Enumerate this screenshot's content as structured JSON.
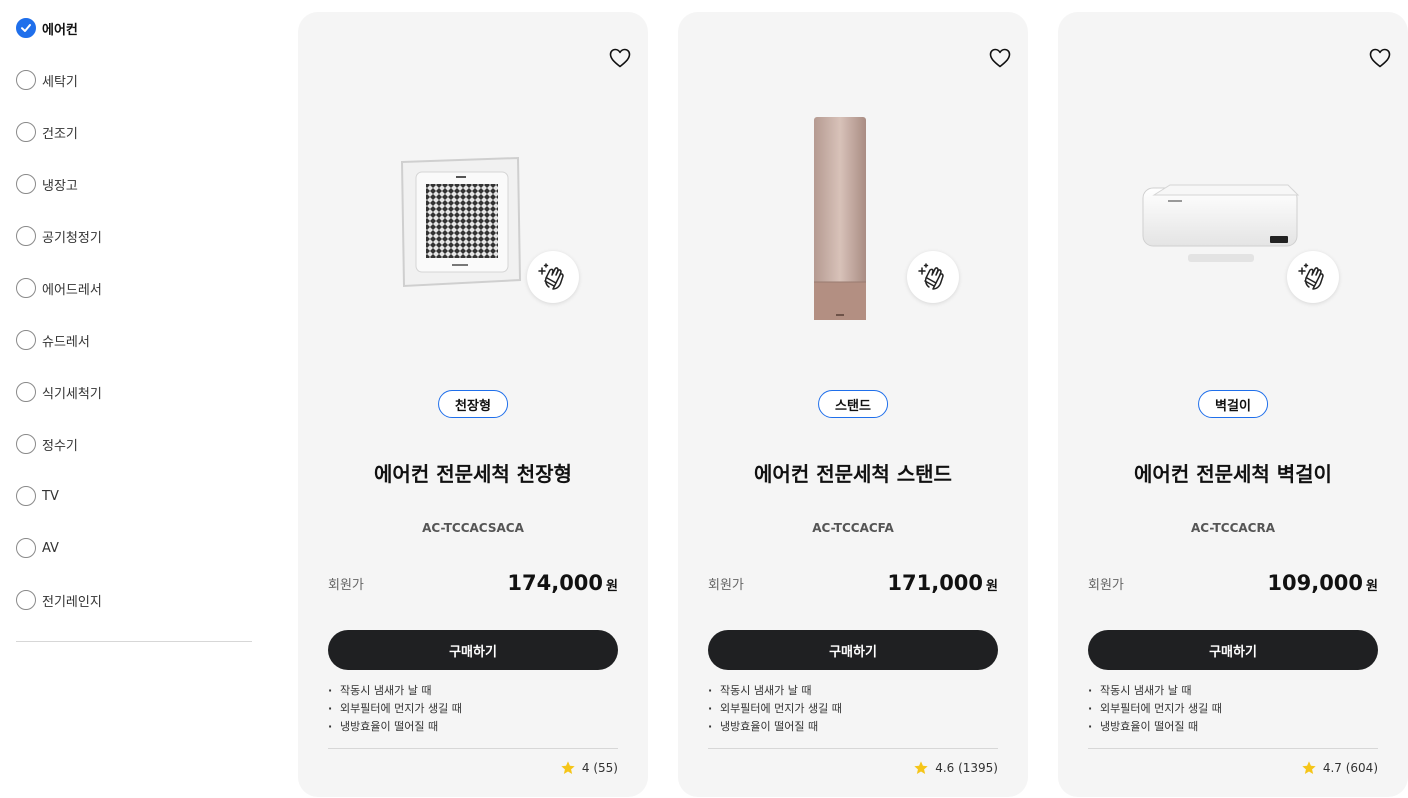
{
  "sidebar": {
    "categories": [
      {
        "label": "에어컨",
        "checked": true
      },
      {
        "label": "세탁기",
        "checked": false
      },
      {
        "label": "건조기",
        "checked": false
      },
      {
        "label": "냉장고",
        "checked": false
      },
      {
        "label": "공기청정기",
        "checked": false
      },
      {
        "label": "에어드레서",
        "checked": false
      },
      {
        "label": "슈드레서",
        "checked": false
      },
      {
        "label": "식기세척기",
        "checked": false
      },
      {
        "label": "정수기",
        "checked": false
      },
      {
        "label": "TV",
        "checked": false
      },
      {
        "label": "AV",
        "checked": false
      },
      {
        "label": "전기레인지",
        "checked": false
      }
    ]
  },
  "colors": {
    "accent": "#1f6feb",
    "card_bg": "#f5f5f5",
    "button_bg": "#1f2022",
    "star": "#f5c518"
  },
  "products": [
    {
      "type_chip": "천장형",
      "title": "에어컨 전문세척 천장형",
      "model": "AC-TCCACSACA",
      "price_label": "회원가",
      "price": "174,000",
      "price_unit": "원",
      "buy_label": "구매하기",
      "bullets": [
        "작동시 냄새가 날 때",
        "외부필터에 먼지가 생길 때",
        "냉방효율이 떨어질 때"
      ],
      "rating": "4 (55)",
      "image_icon": "ceiling-cassette-ac-image",
      "badge_icon": "cleaning-hand-icon",
      "favorite_icon": "heart-icon"
    },
    {
      "type_chip": "스탠드",
      "title": "에어컨 전문세척 스탠드",
      "model": "AC-TCCACFA",
      "price_label": "회원가",
      "price": "171,000",
      "price_unit": "원",
      "buy_label": "구매하기",
      "bullets": [
        "작동시 냄새가 날 때",
        "외부필터에 먼지가 생길 때",
        "냉방효율이 떨어질 때"
      ],
      "rating": "4.6 (1395)",
      "image_icon": "standing-ac-image",
      "badge_icon": "cleaning-hand-icon",
      "favorite_icon": "heart-icon"
    },
    {
      "type_chip": "벽걸이",
      "title": "에어컨 전문세척 벽걸이",
      "model": "AC-TCCACRA",
      "price_label": "회원가",
      "price": "109,000",
      "price_unit": "원",
      "buy_label": "구매하기",
      "bullets": [
        "작동시 냄새가 날 때",
        "외부필터에 먼지가 생길 때",
        "냉방효율이 떨어질 때"
      ],
      "rating": "4.7 (604)",
      "image_icon": "wall-mounted-ac-image",
      "badge_icon": "cleaning-hand-icon",
      "favorite_icon": "heart-icon"
    }
  ]
}
